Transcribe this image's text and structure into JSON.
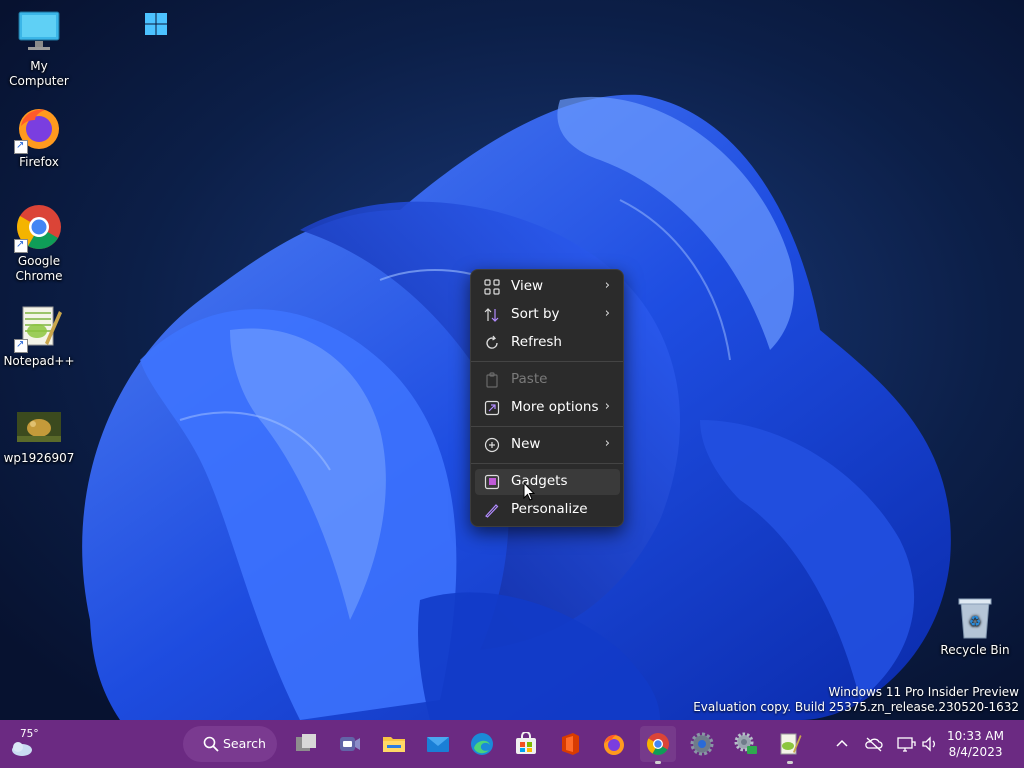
{
  "desktop": {
    "icons": [
      {
        "label": "My Computer",
        "icon": "monitor-icon"
      },
      {
        "label": "Firefox",
        "icon": "firefox-icon"
      },
      {
        "label": "Google Chrome",
        "icon": "chrome-icon"
      },
      {
        "label": "Notepad++",
        "icon": "notepadpp-icon"
      },
      {
        "label": "wp1926907",
        "icon": "image-thumbnail-icon"
      },
      {
        "label": "Recycle Bin",
        "icon": "recycle-bin-icon"
      }
    ]
  },
  "context_menu": {
    "items": [
      {
        "label": "View",
        "icon": "grid-icon",
        "has_submenu": true,
        "enabled": true
      },
      {
        "label": "Sort by",
        "icon": "sort-icon",
        "has_submenu": true,
        "enabled": true
      },
      {
        "label": "Refresh",
        "icon": "refresh-icon",
        "has_submenu": false,
        "enabled": true
      },
      {
        "label": "Paste",
        "icon": "clipboard-icon",
        "has_submenu": false,
        "enabled": false
      },
      {
        "label": "More options",
        "icon": "more-options-icon",
        "has_submenu": true,
        "enabled": true
      },
      {
        "label": "New",
        "icon": "plus-circle-icon",
        "has_submenu": true,
        "enabled": true
      },
      {
        "label": "Gadgets",
        "icon": "gadgets-icon",
        "has_submenu": false,
        "enabled": true,
        "hovered": true
      },
      {
        "label": "Personalize",
        "icon": "brush-icon",
        "has_submenu": false,
        "enabled": true
      }
    ]
  },
  "watermark": {
    "line1": "Windows 11 Pro Insider Preview",
    "line2": "Evaluation copy. Build 25375.zn_release.230520-1632"
  },
  "taskbar": {
    "weather_temp": "75°",
    "search_label": "Search",
    "apps": [
      "start-icon",
      "task-view-icon",
      "teams-icon",
      "file-explorer-icon",
      "mail-icon",
      "edge-icon",
      "store-icon",
      "office-icon",
      "firefox-icon",
      "chrome-icon",
      "settings-icon",
      "settings-alt-icon",
      "notepadpp-icon"
    ],
    "clock_time": "10:33 AM",
    "clock_date": "8/4/2023"
  },
  "colors": {
    "taskbar": "#6b2a82",
    "menu_bg": "#2b2b2b",
    "accent": "#2a5bff"
  }
}
